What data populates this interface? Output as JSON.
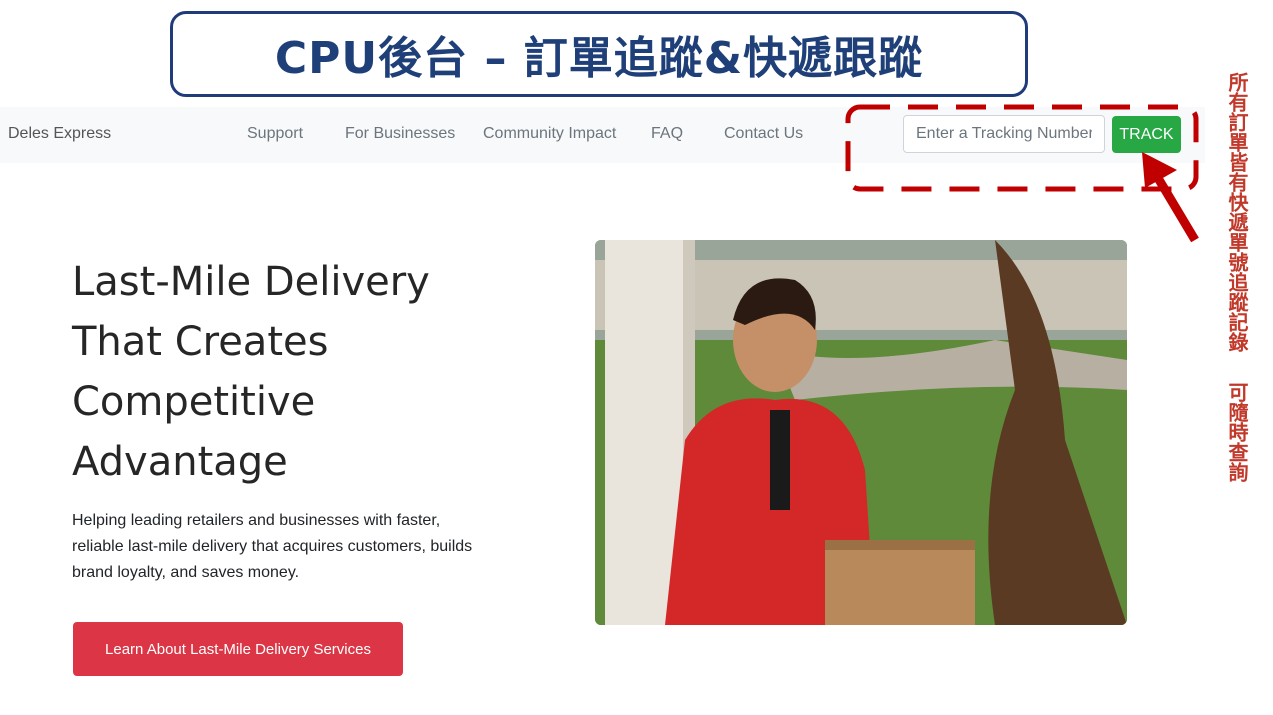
{
  "banner": {
    "title": "CPU後台 – 訂單追蹤&快遞跟蹤"
  },
  "navbar": {
    "brand": "Deles Express",
    "links": [
      "Support",
      "For Businesses",
      "Community Impact",
      "FAQ",
      "Contact Us"
    ],
    "tracking_placeholder": "Enter a Tracking Number",
    "track_button": "TRACK"
  },
  "hero": {
    "title_lines": [
      "Last-Mile Delivery",
      "That Creates",
      "Competitive",
      "Advantage"
    ],
    "description_lines": [
      "Helping leading retailers and businesses with faster,",
      "reliable last-mile delivery that acquires customers, builds",
      "brand loyalty, and saves money."
    ],
    "cta_label": "Learn About Last-Mile Delivery Services"
  },
  "annotation": {
    "note_part1": "所有訂單皆有快遞單號追蹤記錄",
    "note_part2": "可隨時查詢"
  },
  "colors": {
    "banner_border": "#1f3b7a",
    "banner_text": "#1e3f78",
    "track_green": "#28a745",
    "cta_red": "#dc3545",
    "annotation_red": "#c00000"
  }
}
